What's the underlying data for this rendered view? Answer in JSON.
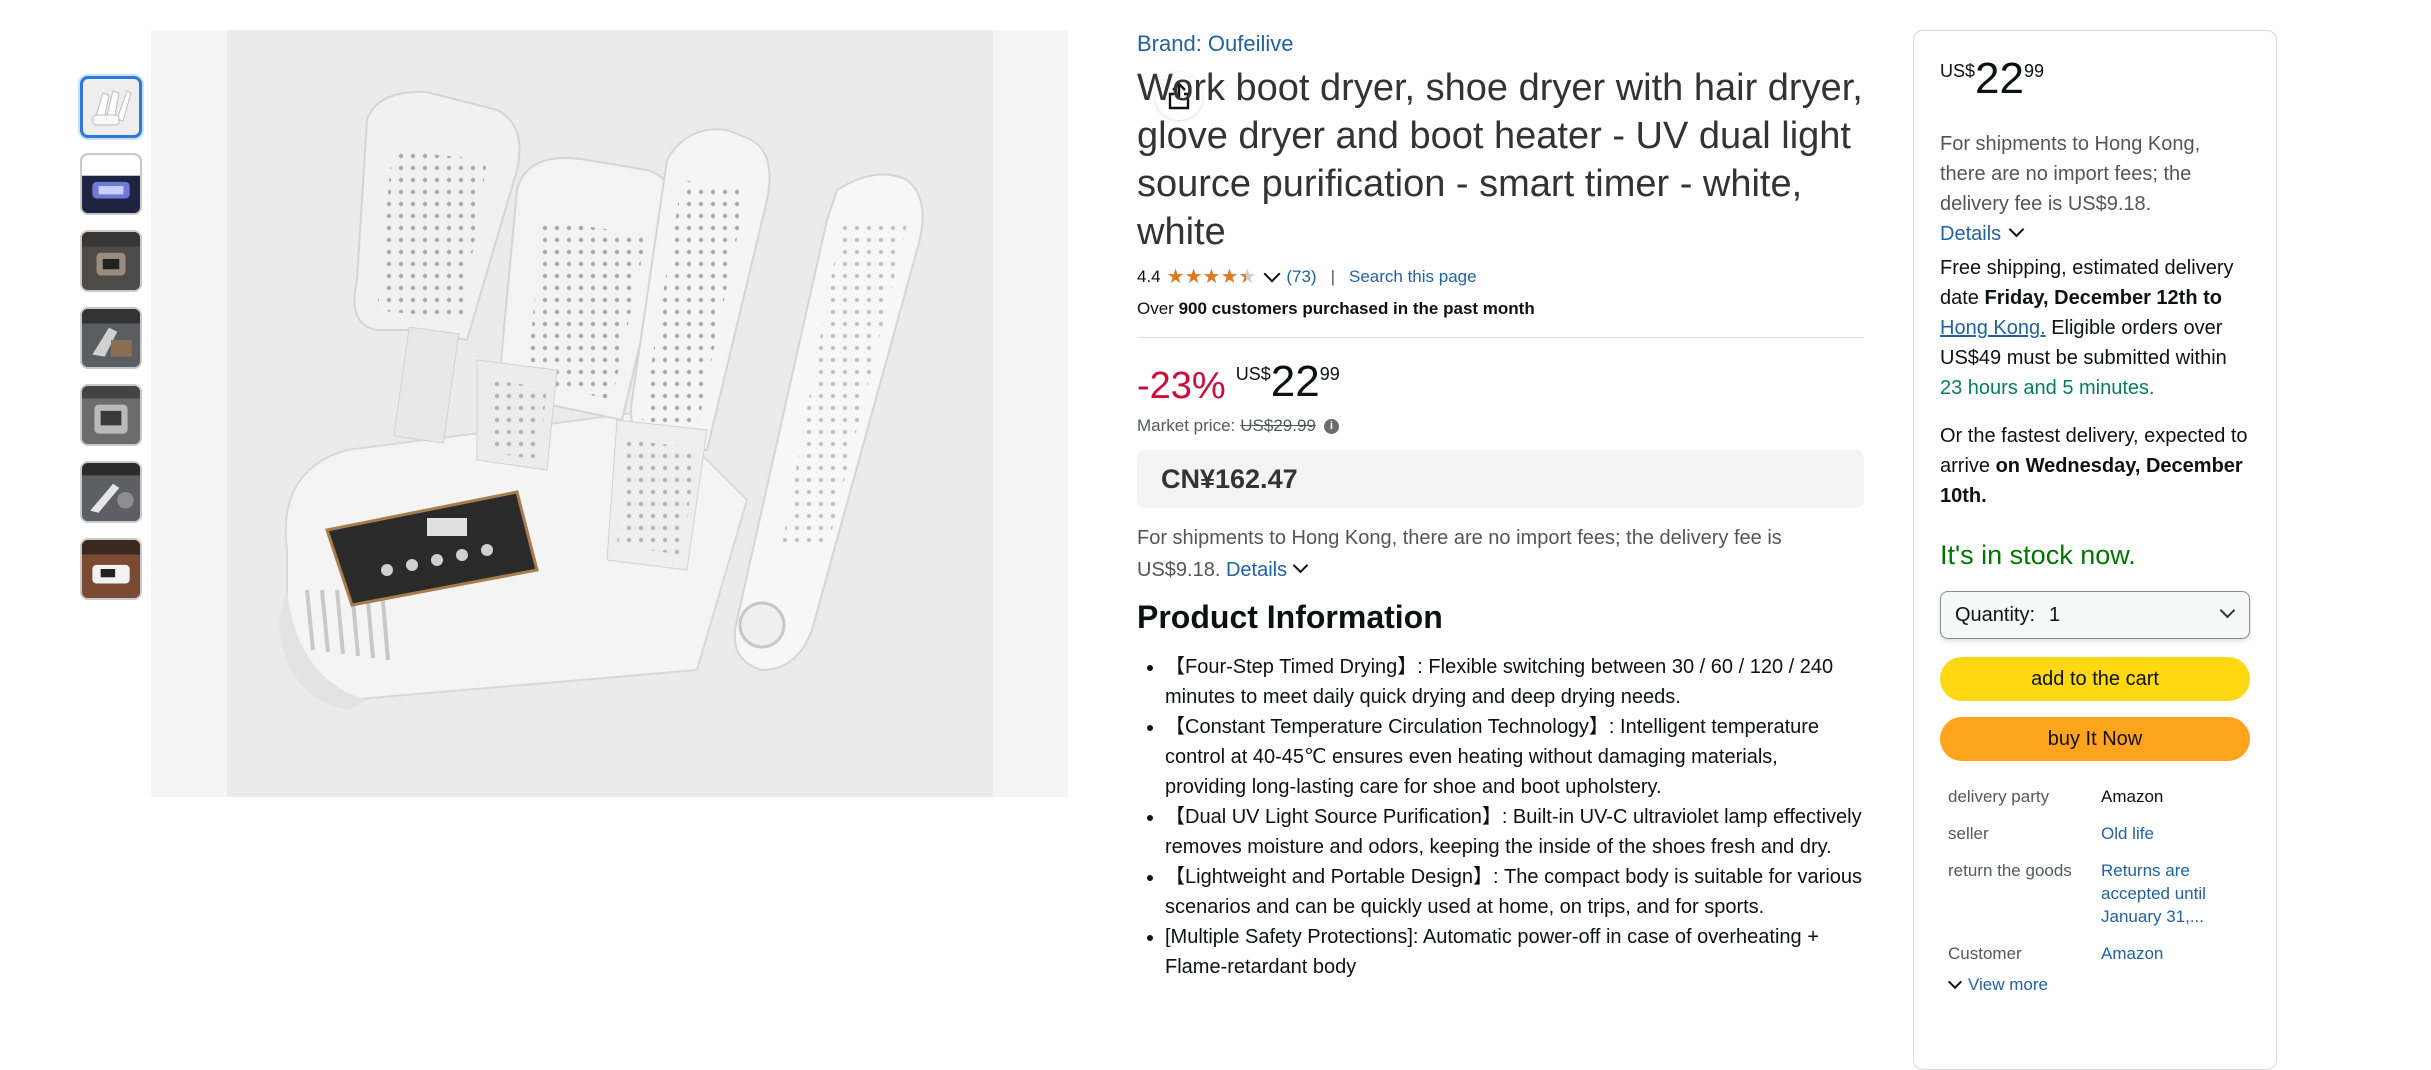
{
  "gallery": {
    "thumbnail_count": 7,
    "thumbnails": [
      {
        "label": "",
        "selected": true
      },
      {
        "label": "",
        "selected": false
      },
      {
        "label": "",
        "selected": false
      },
      {
        "label": "",
        "selected": false
      },
      {
        "label": "",
        "selected": false
      },
      {
        "label": "",
        "selected": false
      },
      {
        "label": "",
        "selected": false
      }
    ],
    "share_icon": "share-icon"
  },
  "product": {
    "brand": "Brand: Oufeilive",
    "title": "Work boot dryer, shoe dryer with hair dryer, glove dryer and boot heater - UV dual light source purification - smart timer - white, white",
    "rating_value": "4.4",
    "rating_stars": 4.4,
    "rating_count": "(73)",
    "search_link": "Search this page",
    "purchased_prefix": "Over ",
    "purchased_bold": "900 customers purchased in the past month",
    "discount": "-23%",
    "currency": "US$",
    "price_whole": "22",
    "price_fraction": "99",
    "market_label": "Market price:",
    "market_price": "US$29.99",
    "converted_price": "CN¥162.47",
    "ship_note": "For shipments to Hong Kong, there are no import fees; the delivery fee is US$9.18.",
    "details_label": "Details",
    "info_heading": "Product Information",
    "bullets": [
      "【Four-Step Timed Drying】: Flexible switching between 30 / 60 / 120 / 240 minutes to meet daily quick drying and deep drying needs.",
      "【Constant Temperature Circulation Technology】: Intelligent temperature control at 40-45℃ ensures even heating without damaging materials, providing long-lasting care for shoe and boot upholstery.",
      "【Dual UV Light Source Purification】: Built-in UV-C ultraviolet lamp effectively removes moisture and odors, keeping the inside of the shoes fresh and dry.",
      "【Lightweight and Portable Design】: The compact body is suitable for various scenarios and can be quickly used at home, on trips, and for sports.",
      "[Multiple Safety Protections]: Automatic power-off in case of overheating + Flame-retardant body"
    ]
  },
  "buybox": {
    "currency": "US$",
    "price_whole": "22",
    "price_fraction": "99",
    "ship_note": "For shipments to Hong Kong, there are no import fees; the delivery fee is US$9.18.",
    "details_label": "Details",
    "free_prefix": "Free shipping, estimated delivery date ",
    "free_date": "Friday, December 12th to ",
    "free_place": "Hong Kong.",
    "free_mid": " Eligible orders over US$49 must be submitted within ",
    "free_time": "23 hours and 5 minutes.",
    "fast_prefix": "Or the fastest delivery, expected to arrive ",
    "fast_bold": "on Wednesday, December 10th.",
    "stock": "It's in stock now.",
    "qty_label": "Quantity:",
    "qty_value": "1",
    "add_to_cart": "add to the cart",
    "buy_now": "buy It Now",
    "meta": [
      {
        "key": "delivery party",
        "value": "Amazon",
        "link": false
      },
      {
        "key": "seller",
        "value": "Old life",
        "link": true
      },
      {
        "key": "return the goods",
        "value": "Returns are accepted until January 31,...",
        "link": true
      },
      {
        "key": "Customer",
        "value": "Amazon",
        "link": true
      }
    ],
    "view_more": "View more"
  },
  "colors": {
    "link": "#2162a1",
    "discount": "#cc0c39",
    "stock": "#007600",
    "cart_button": "#ffd814",
    "buy_button": "#ffa41c",
    "star": "#de7921"
  }
}
